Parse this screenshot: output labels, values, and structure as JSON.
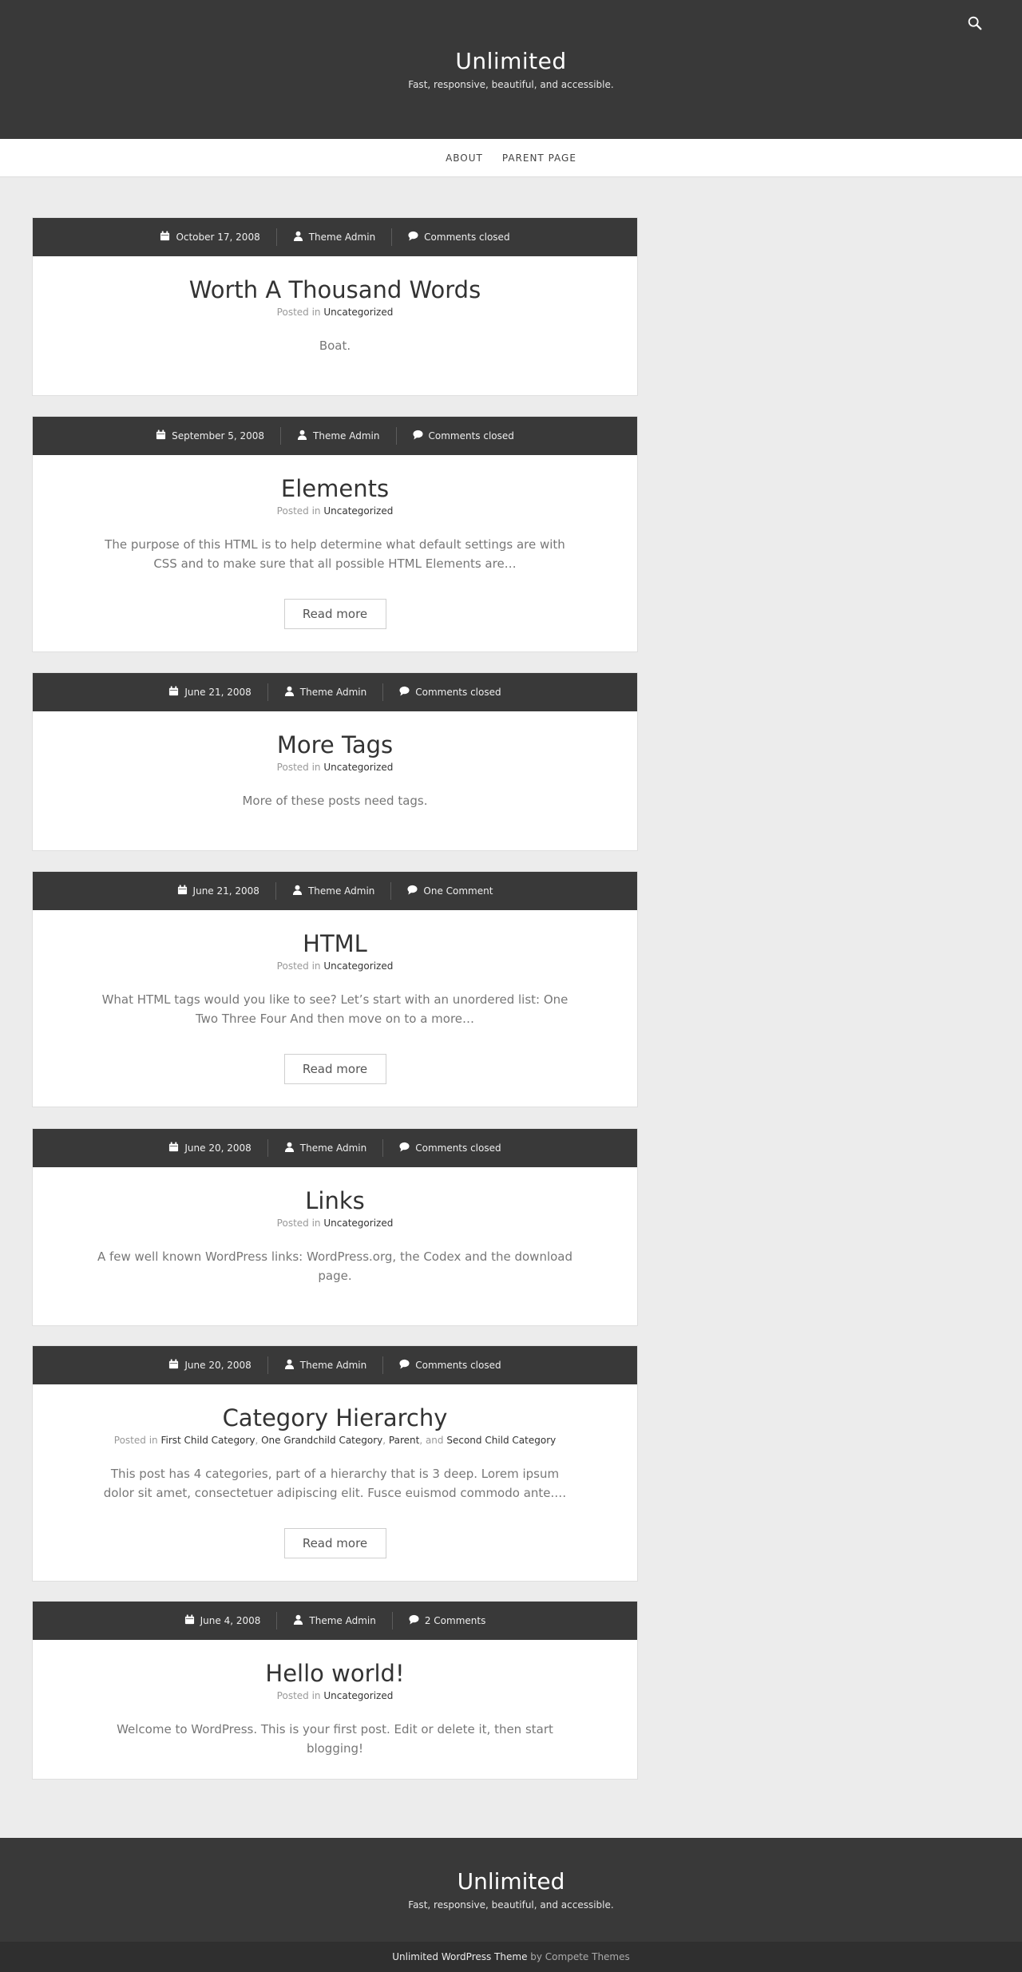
{
  "header": {
    "site_title": "Unlimited",
    "tagline": "Fast, responsive, beautiful, and accessible.",
    "search_icon": "search-icon"
  },
  "nav": {
    "items": [
      {
        "label": "ABOUT"
      },
      {
        "label": "PARENT PAGE"
      }
    ]
  },
  "posts": [
    {
      "date": "October 17, 2008",
      "author": "Theme Admin",
      "comments": "Comments closed",
      "title": "Worth A Thousand Words",
      "posted_in": "Posted in",
      "categories": [
        "Uncategorized"
      ],
      "excerpt": "Boat."
    },
    {
      "date": "September 5, 2008",
      "author": "Theme Admin",
      "comments": "Comments closed",
      "title": "Elements",
      "posted_in": "Posted in",
      "categories": [
        "Uncategorized"
      ],
      "excerpt": "The purpose of this HTML is to help determine what default settings are with CSS and to make sure that all possible HTML Elements are…",
      "read_more": "Read more"
    },
    {
      "date": "June 21, 2008",
      "author": "Theme Admin",
      "comments": "Comments closed",
      "title": "More Tags",
      "posted_in": "Posted in",
      "categories": [
        "Uncategorized"
      ],
      "excerpt": "More of these posts need tags."
    },
    {
      "date": "June 21, 2008",
      "author": "Theme Admin",
      "comments": "One Comment",
      "title": "HTML",
      "posted_in": "Posted in",
      "categories": [
        "Uncategorized"
      ],
      "excerpt": "What HTML tags would you like to see? Let’s start with an unordered list: One Two Three Four And then move on to a more…",
      "read_more": "Read more"
    },
    {
      "date": "June 20, 2008",
      "author": "Theme Admin",
      "comments": "Comments closed",
      "title": "Links",
      "posted_in": "Posted in",
      "categories": [
        "Uncategorized"
      ],
      "excerpt": "A few well known WordPress links: WordPress.org, the Codex and the download page."
    },
    {
      "date": "June 20, 2008",
      "author": "Theme Admin",
      "comments": "Comments closed",
      "title": "Category Hierarchy",
      "posted_in": "Posted in",
      "categories": [
        "First Child Category",
        "One Grandchild Category",
        "Parent",
        "Second Child Category"
      ],
      "separators": [
        ", ",
        ", ",
        ", and "
      ],
      "excerpt": "This post has 4 categories, part of a hierarchy that is 3 deep. Lorem ipsum dolor sit amet, consectetuer adipiscing elit. Fusce euismod commodo ante.…",
      "read_more": "Read more"
    },
    {
      "date": "June 4, 2008",
      "author": "Theme Admin",
      "comments": "2 Comments",
      "title": "Hello world!",
      "posted_in": "Posted in",
      "categories": [
        "Uncategorized"
      ],
      "excerpt": "Welcome to WordPress. This is your first post. Edit or delete it, then start blogging!"
    }
  ],
  "footer": {
    "site_title": "Unlimited",
    "tagline": "Fast, responsive, beautiful, and accessible.",
    "credit_link": "Unlimited WordPress Theme",
    "credit_by": " by Compete Themes"
  },
  "icons": {
    "date": "calendar-icon",
    "author": "user-icon",
    "comments": "comment-icon"
  }
}
